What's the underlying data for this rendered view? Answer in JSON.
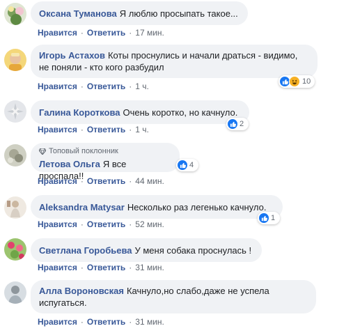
{
  "comments": [
    {
      "author": "Оксана Туманова",
      "text": "Я люблю просыпать такое...",
      "like": "Нравится",
      "reply": "Ответить",
      "time": "17 мин.",
      "avatar_color": "#7ba05b"
    },
    {
      "author": "Игорь Астахов",
      "text": "Коты проснулись и начали драться - видимо, не поняли - кто кого разбудил",
      "like": "Нравится",
      "reply": "Ответить",
      "time": "1 ч.",
      "reactions_count": "10",
      "reaction_icons": [
        "like-icon",
        "haha-icon"
      ],
      "avatar_color": "#e8b94a"
    },
    {
      "author": "Галина Короткова",
      "text": "Очень коротко, но качнуло.",
      "like": "Нравится",
      "reply": "Ответить",
      "time": "1 ч.",
      "reactions_count": "2",
      "reaction_icons": [
        "like-icon"
      ],
      "avatar_color": "#c9cdd2"
    },
    {
      "badge": "Топовый поклонник",
      "author": "Летова Ольга",
      "text": "Я все проспала!!",
      "like": "Нравится",
      "reply": "Ответить",
      "time": "44 мин.",
      "reactions_count": "4",
      "reaction_icons": [
        "like-icon"
      ],
      "avatar_color": "#a7a795"
    },
    {
      "author": "Aleksandra Matysar",
      "text": "Несколько раз легенько качнуло.",
      "like": "Нравится",
      "reply": "Ответить",
      "time": "52 мин.",
      "reactions_count": "1",
      "reaction_icons": [
        "like-icon"
      ],
      "avatar_color": "#d8cfc4"
    },
    {
      "author": "Светлана Горобьева",
      "text": "У меня собака проснулась !",
      "like": "Нравится",
      "reply": "Ответить",
      "time": "31 мин.",
      "avatar_color": "#6fa548"
    },
    {
      "author": "Алла Вороновская",
      "text": "Качнуло,но слабо,даже не успела испугаться.",
      "like": "Нравится",
      "reply": "Ответить",
      "time": "31 мин.",
      "avatar_color": "#a6b0b8"
    }
  ],
  "colors": {
    "link": "#385898",
    "bubble": "#f0f2f5",
    "like": "#1877f2"
  }
}
